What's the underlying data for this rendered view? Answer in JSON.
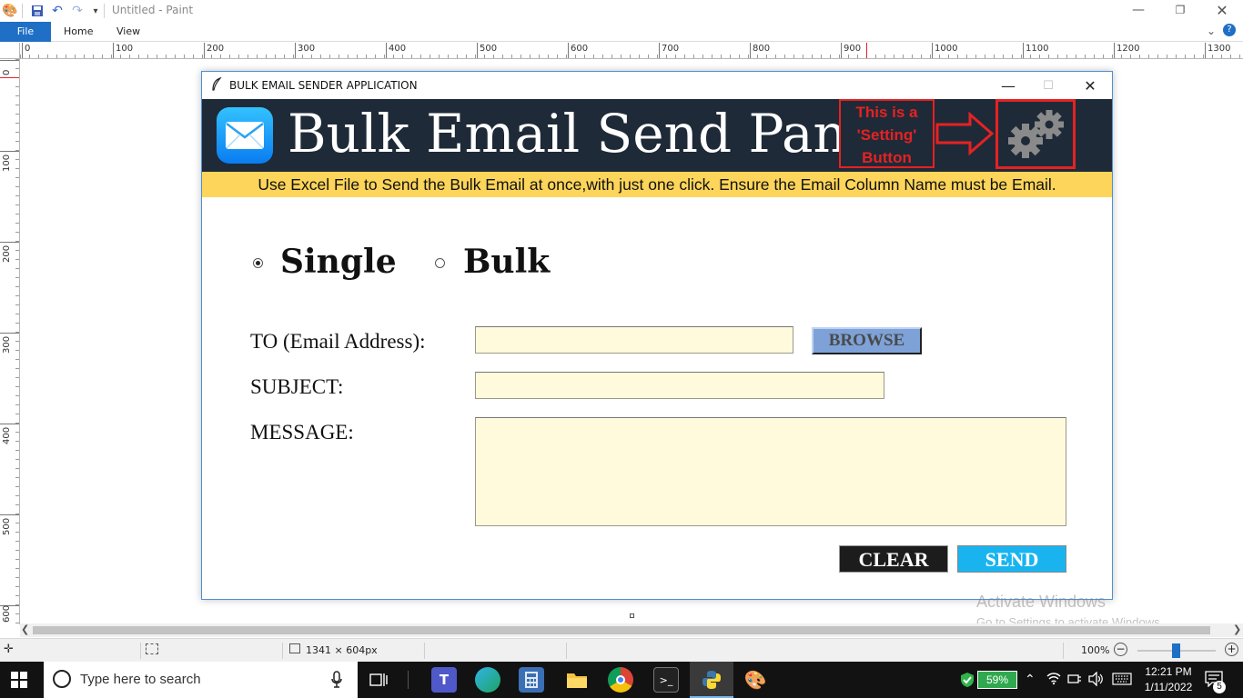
{
  "paint": {
    "title": "Untitled - Paint",
    "tabs": [
      "File",
      "Home",
      "View"
    ],
    "ruler_top": [
      "0",
      "100",
      "200",
      "300",
      "400",
      "500",
      "600",
      "700",
      "800",
      "900",
      "1000",
      "1100",
      "1200",
      "1300"
    ],
    "ruler_left": [
      "0",
      "100",
      "200",
      "300",
      "400",
      "500",
      "600"
    ],
    "status": {
      "dimensions": "1341 × 604px",
      "zoom": "100%"
    },
    "watermark": {
      "line1": "Activate Windows",
      "line2": "Go to Settings to activate Windows."
    }
  },
  "app": {
    "window_title": "BULK EMAIL SENDER APPLICATION",
    "banner_title": "Bulk Email Send Panel",
    "annotation": [
      "This is a",
      "'Setting'",
      "Button"
    ],
    "info_text": "Use Excel File to Send the Bulk Email at once,with just one click. Ensure the Email Column Name must be Email.",
    "mode_options": [
      {
        "label": "Single",
        "selected": true
      },
      {
        "label": "Bulk",
        "selected": false
      }
    ],
    "fields": {
      "to_label": "TO (Email Address):",
      "subject_label": "SUBJECT:",
      "message_label": "MESSAGE:",
      "to_value": "",
      "subject_value": "",
      "message_value": ""
    },
    "buttons": {
      "browse": "BROWSE",
      "clear": "CLEAR",
      "send": "SEND"
    },
    "colors": {
      "banner_bg": "#1f2a38",
      "info_strip": "#fdd55a",
      "entry_bg": "#fffadc",
      "annotation": "#e52222",
      "send_bg": "#19b4f0",
      "browse_bg": "#7ea2d8"
    }
  },
  "taskbar": {
    "search_placeholder": "Type here to search",
    "battery": "59%",
    "time": "12:21 PM",
    "date": "1/11/2022",
    "notifications": "5"
  }
}
